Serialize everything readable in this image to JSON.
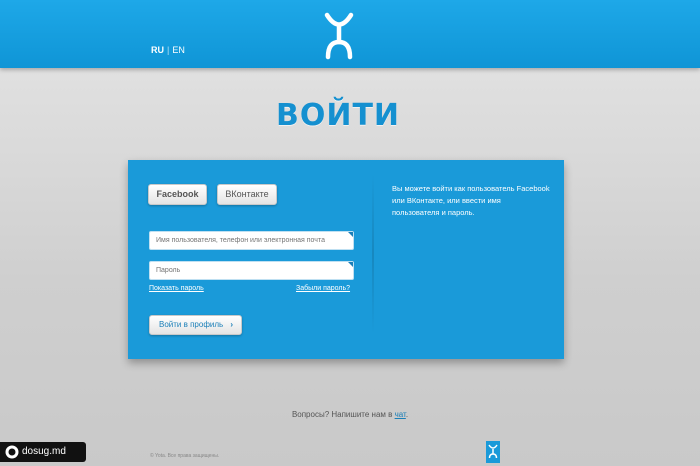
{
  "header": {
    "lang_ru": "RU",
    "lang_sep": "|",
    "lang_en": "EN",
    "logo_icon": "yota-logo-icon"
  },
  "title": "ВОЙТИ",
  "social": {
    "facebook_label": "Facebook",
    "vk_label": "ВКонтакте"
  },
  "form": {
    "username_placeholder": "Имя пользователя, телефон или электронная почта",
    "password_placeholder": "Пароль",
    "show_password": "Показать пароль",
    "forgot_password": "Забыли пароль?",
    "login_button": "Войти в профиль",
    "login_chevron": "›"
  },
  "info_text": "Вы можете войти как пользователь Facebook или ВКонтакте, или ввести имя пользователя и пароль.",
  "footer": {
    "questions_prefix": "Вопросы? Напишите нам в ",
    "chat_link": "чат",
    "questions_suffix": ".",
    "copyright": "© Yota. Все права защищены."
  },
  "watermark": {
    "text": "dosug.md"
  },
  "colors": {
    "brand_blue": "#1a9ad9",
    "header_blue": "#1ea8e8",
    "title_blue": "#1590d0"
  }
}
